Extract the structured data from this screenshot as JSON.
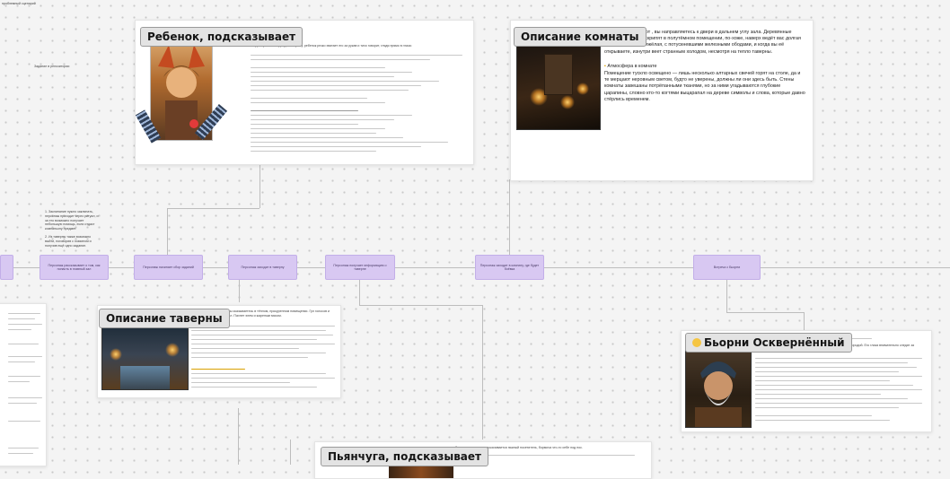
{
  "canvas": {
    "top_left_note": "проблемный сценарий",
    "left_note": "Задание в репозитории"
  },
  "cards": {
    "child": {
      "title": "Ребенок, подсказывает",
      "snippet": "Когда персонаж подходит к стражу, ребенок резко хватает его за рукав и тихо говорит, глядя прямо в глаза:"
    },
    "room": {
      "title": "Описание комнаты",
      "text": "получив указание от , вы направляетесь к двери в дальнем углу зала. Деревянные доски под ногами скрипят в полутёмном помещении, по-хоже, наверх ведёт вас долгая лестница. Дверь тяжёлая, с потускневшими железными ободами, и когда вы её открываете, изнутри веет странным холодом, несмотря на тепло таверны.",
      "atmosphere_heading": "Атмосфера в комнате",
      "atmosphere_text": "Помещение тускло освещено — лишь несколько алтарных свечей горят на столе, да и те мерцают неровным светом, будто не уверены, должны ли они здесь быть. Стены комнаты завешаны потрёпанными тканями, но за ними угадываются глубокие царапины, словно кто-то когтями выцарапал на дереве символы и слова, которые давно стёрлись временем."
    },
    "tavern": {
      "title": "Описание таверны",
      "snippet": "Открыв тяжёлую дверь, вы оказываетесь в тёплом, прокуренном помещении. Гул голосов и звон кружек заполняют зал. Пахнет элем и жареным мясом."
    },
    "bjorn": {
      "title": "Бьорни Осквернённый",
      "snippet": "За дальним столом сидит коренастый мужчина с густой седой бородой. Его глаза внимательно следят за каждым, кто входит. Шрам пересекает его щёку."
    },
    "drunk": {
      "title": "Пьянчуга, подсказывает",
      "snippet": "За соседним столом покачивается пьяный посетитель, бормоча что-то себе под нос."
    }
  },
  "flow_nodes": [
    "Персонаж рассказывает о том, как попасть в главный зал",
    "Персонаж начинает сбор заданий",
    "Персонаж заходит в таверну",
    "Персонаж получает информацию о таверне",
    "Персонаж заходит в комнату, где будет боёвка",
    "Встреча с Бьорни"
  ],
  "left_notes": {
    "note1": "1. Заклинание нужно заклинать, персонаж проходит через ритуал, и за это возможно получает небольшую помощь, если отдаст компаньону предмет.",
    "note2": "2. Из таверны также возможно выйти, поговорив с хозяином и получив ещё одно задание."
  },
  "colors": {
    "node_fill": "#d8c8f2",
    "title_chip": "#e3e3e3",
    "canvas": "#f4f4f4"
  }
}
